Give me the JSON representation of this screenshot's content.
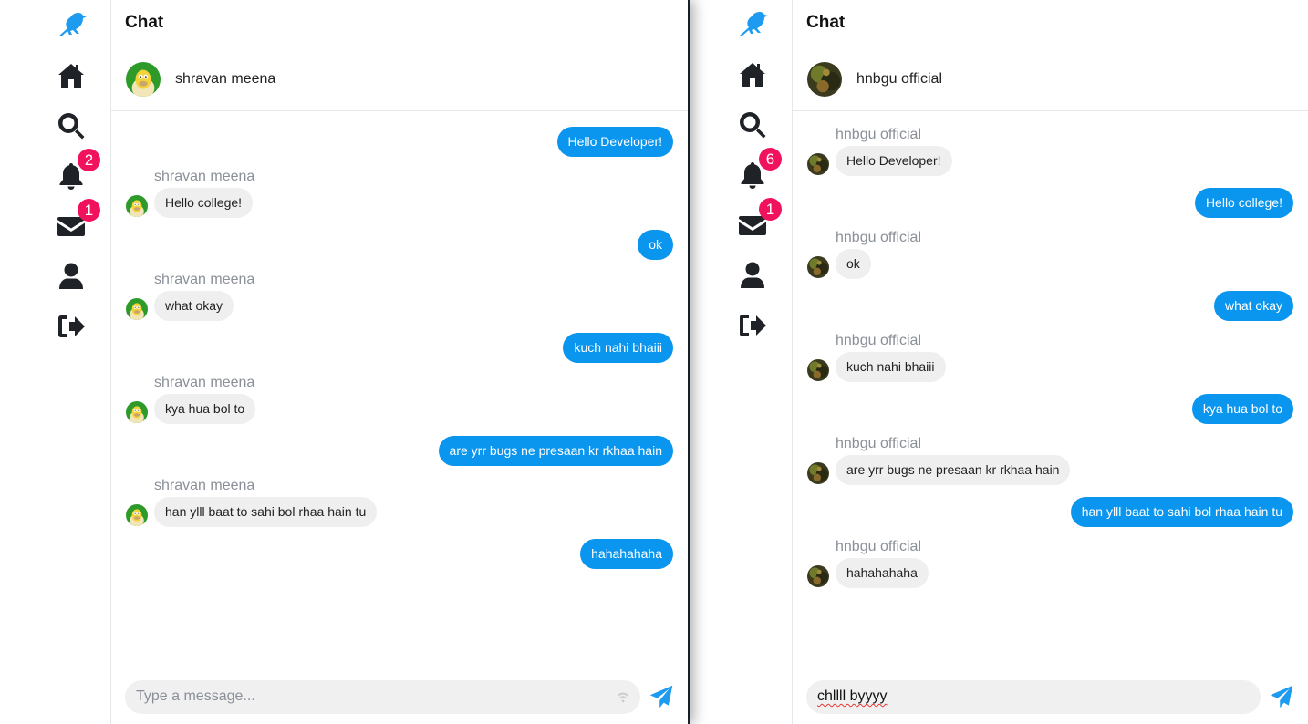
{
  "colors": {
    "accent": "#1d9bf0",
    "outgoing_bubble": "#0a95ee",
    "incoming_bubble": "#efefef",
    "badge": "#f0125c",
    "sender_name": "#8a8f98"
  },
  "left_window": {
    "header_title": "Chat",
    "nav": [
      {
        "icon": "bird-logo-icon"
      },
      {
        "icon": "home-icon"
      },
      {
        "icon": "search-icon"
      },
      {
        "icon": "bell-icon",
        "badge": "2"
      },
      {
        "icon": "envelope-icon",
        "badge": "1"
      },
      {
        "icon": "user-icon"
      },
      {
        "icon": "logout-icon"
      }
    ],
    "contact": {
      "name": "shravan meena",
      "avatar": "cartoon-avatar"
    },
    "messages": [
      {
        "dir": "out",
        "text": "Hello Developer!"
      },
      {
        "dir": "in",
        "sender": "shravan meena",
        "text": "Hello college!"
      },
      {
        "dir": "out",
        "text": "ok"
      },
      {
        "dir": "in",
        "sender": "shravan meena",
        "text": "what okay"
      },
      {
        "dir": "out",
        "text": "kuch nahi bhaiii"
      },
      {
        "dir": "in",
        "sender": "shravan meena",
        "text": "kya hua bol to"
      },
      {
        "dir": "out",
        "text": "are yrr bugs ne presaan kr rkhaa hain"
      },
      {
        "dir": "in",
        "sender": "shravan meena",
        "text": "han ylll baat to sahi bol rhaa hain tu"
      },
      {
        "dir": "out",
        "text": "hahahahaha"
      }
    ],
    "composer": {
      "value": "",
      "placeholder": "Type a message..."
    }
  },
  "right_window": {
    "header_title": "Chat",
    "nav": [
      {
        "icon": "bird-logo-icon"
      },
      {
        "icon": "home-icon"
      },
      {
        "icon": "search-icon"
      },
      {
        "icon": "bell-icon",
        "badge": "6"
      },
      {
        "icon": "envelope-icon",
        "badge": "1"
      },
      {
        "icon": "user-icon"
      },
      {
        "icon": "logout-icon"
      }
    ],
    "contact": {
      "name": "hnbgu official",
      "avatar": "photo-avatar"
    },
    "messages": [
      {
        "dir": "in",
        "sender": "hnbgu official",
        "text": "Hello Developer!"
      },
      {
        "dir": "out",
        "text": "Hello college!"
      },
      {
        "dir": "in",
        "sender": "hnbgu official",
        "text": "ok"
      },
      {
        "dir": "out",
        "text": "what okay"
      },
      {
        "dir": "in",
        "sender": "hnbgu official",
        "text": "kuch nahi bhaiii"
      },
      {
        "dir": "out",
        "text": "kya hua bol to"
      },
      {
        "dir": "in",
        "sender": "hnbgu official",
        "text": "are yrr bugs ne presaan kr rkhaa hain"
      },
      {
        "dir": "out",
        "text": "han ylll baat to sahi bol rhaa hain tu"
      },
      {
        "dir": "in",
        "sender": "hnbgu official",
        "text": "hahahahaha"
      }
    ],
    "composer": {
      "value": "chllll byyyy",
      "placeholder": "Type a message..."
    }
  }
}
